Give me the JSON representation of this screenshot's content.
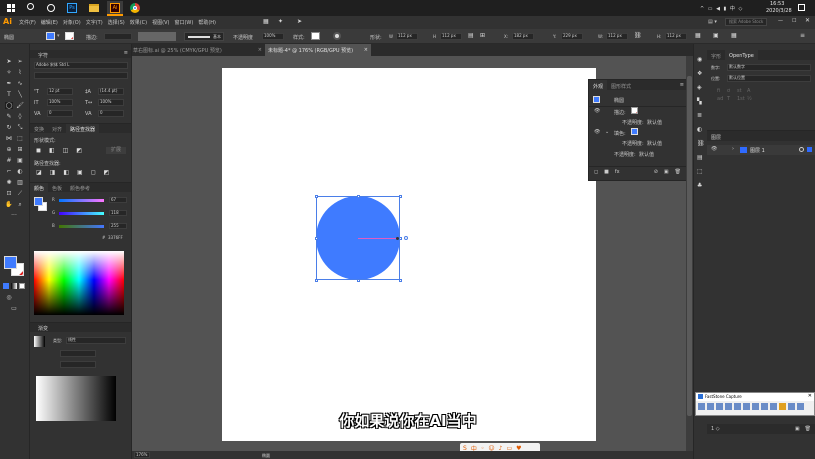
{
  "taskbar": {
    "time": "16:53",
    "date": "2020/3/28",
    "app_icons": [
      "start-icon",
      "search-icon",
      "cortana-icon",
      "taskview-icon",
      "photoshop-icon",
      "explorer-icon",
      "illustrator-icon",
      "chrome-icon"
    ],
    "ps_label": "Ps",
    "ai_label": "Ai"
  },
  "menubar": {
    "logo": "Ai",
    "items": [
      "文件(F)",
      "编辑(E)",
      "对象(O)",
      "文字(T)",
      "选择(S)",
      "效果(C)",
      "视图(V)",
      "窗口(W)",
      "帮助(H)"
    ],
    "search_placeholder": "搜索 Adobe Stock"
  },
  "control": {
    "type_label": "椭圆",
    "stroke_label": "描边:",
    "stroke_style": "基本",
    "opacity_label": "不透明度",
    "opacity_value": "100%",
    "style_label": "样式:",
    "shape_label": "形状:",
    "w_value": "112 px",
    "h_value": "112 px",
    "x_value": "182 px",
    "y_value": "229 px",
    "pw_value": "112 px",
    "ph_value": "112 px"
  },
  "tabs": [
    {
      "label": "草右图标.ai @ 25% (CMYK/GPU 预览)"
    },
    {
      "label": "未标题-4* @ 176% (RGB/GPU 预览)"
    }
  ],
  "char_panel": {
    "title": "字符",
    "font_name": "Adobe 宋体 Std L",
    "size": "12 pt",
    "leading": "(14.4 pt)",
    "h_scale": "100%",
    "v_scale": "100%",
    "kerning": "0",
    "tracking": "0"
  },
  "pathfinder": {
    "tabs": [
      "变换",
      "对齐",
      "路径查找器"
    ],
    "shape_modes_label": "形状模式:",
    "pathfinders_label": "路径查找器:",
    "expand": "扩展"
  },
  "color_panel": {
    "tabs": [
      "颜色",
      "色板",
      "颜色参考"
    ],
    "r": "67",
    "g": "118",
    "b": "255",
    "hex": "3376FF"
  },
  "gradient_panel": {
    "title": "渐变",
    "type_label": "类型:",
    "type_value": "线性"
  },
  "appearance": {
    "tabs": [
      "外观",
      "图形样式"
    ],
    "object_label": "椭圆",
    "stroke_label": "描边:",
    "opacity_label": "不透明度:",
    "opacity_value": "默认值",
    "fill_label": "填色:",
    "colors": {
      "fill": "#3f7bff"
    }
  },
  "right_panel": {
    "tabs": [
      "字形",
      "OpenType"
    ],
    "figure_label": "数字:",
    "figure_value": "默认数字",
    "position_label": "位置:",
    "position_value": "默认位置",
    "layers_title": "图层",
    "layer_name": "图层 1"
  },
  "faststone": {
    "title": "FastStone Capture"
  },
  "subtitle": "你如果说你在AI当中",
  "status": {
    "zoom": "176%",
    "mode": "椭圆"
  },
  "colors": {
    "accent": "#3f7bff",
    "ui_dark": "#323232",
    "canvas": "#535353"
  }
}
